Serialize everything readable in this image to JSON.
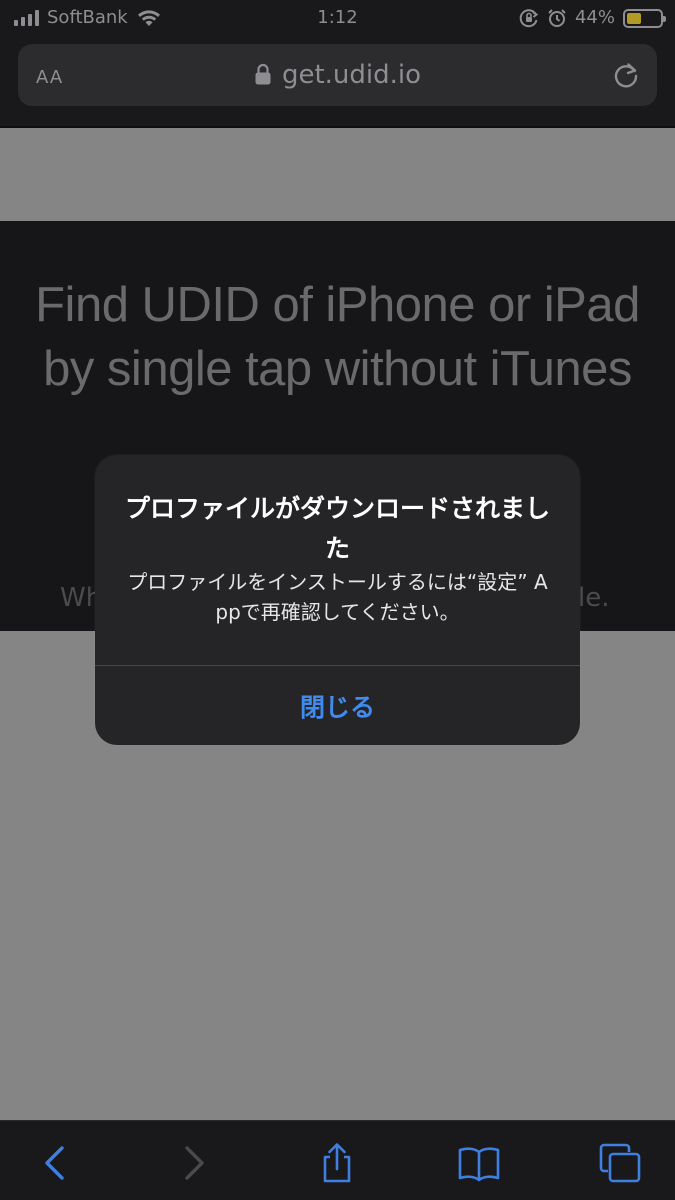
{
  "status_bar": {
    "carrier": "SoftBank",
    "time": "1:12",
    "battery_percent": "44%",
    "battery_level": 0.44,
    "battery_color": "#b39a24",
    "icons": [
      "signal-icon",
      "wifi-icon",
      "orientation-lock-icon",
      "alarm-icon",
      "battery-icon"
    ]
  },
  "browser": {
    "text_size_label": "AA",
    "url": "get.udid.io",
    "icons": [
      "lock-icon",
      "reload-icon"
    ]
  },
  "page": {
    "hero_title_line1": "Find UDID of iPhone or iPad",
    "hero_title_line2": "by single tap without iTunes",
    "hero_sub_left": "Wh",
    "hero_sub_right": "le."
  },
  "alert": {
    "title": "プロファイルがダウンロードされました",
    "message": "プロファイルをインストールするには“設定” Appで再確認してください。",
    "close_label": "閉じる",
    "accent_color": "#3f8bf0"
  },
  "toolbar": {
    "icons": [
      "back-icon",
      "forward-icon",
      "share-icon",
      "bookmarks-icon",
      "tabs-icon"
    ]
  }
}
